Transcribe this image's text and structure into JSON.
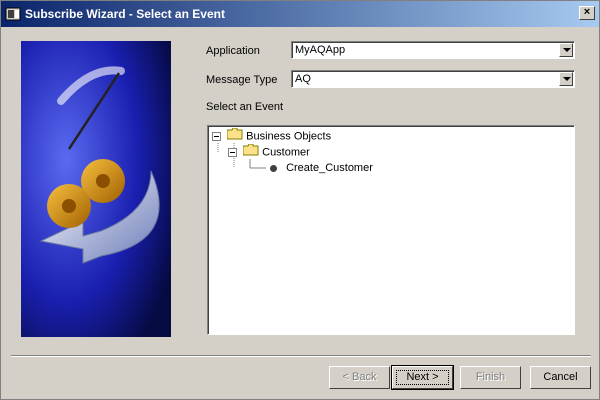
{
  "window": {
    "title": "Subscribe Wizard  - Select an Event",
    "close_label": "×"
  },
  "form": {
    "application_label": "Application",
    "application_value": "MyAQApp",
    "message_type_label": "Message Type",
    "message_type_value": "AQ",
    "select_event_label": "Select an Event"
  },
  "tree": {
    "root": "Business Objects",
    "child": "Customer",
    "leaf": "Create_Customer"
  },
  "buttons": {
    "back": "< Back",
    "next": "Next >",
    "finish": "Finish",
    "cancel": "Cancel"
  },
  "colors": {
    "title_start": "#0a246a",
    "title_end": "#a6caf0",
    "face": "#d4d0c8"
  }
}
